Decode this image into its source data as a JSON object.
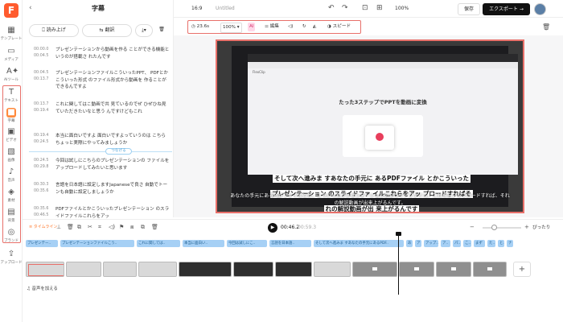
{
  "app": {
    "logo_letter": "F"
  },
  "rail": {
    "items": [
      {
        "label": "テンプレート",
        "icon": "template-icon"
      },
      {
        "label": "メディア",
        "icon": "media-icon"
      },
      {
        "label": "AIツール",
        "icon": "ai-icon"
      },
      {
        "label": "テキスト",
        "icon": "text-icon"
      },
      {
        "label": "字幕",
        "icon": "subtitle-icon"
      },
      {
        "label": "ビデオ",
        "icon": "video-icon"
      },
      {
        "label": "画像",
        "icon": "image-icon"
      },
      {
        "label": "音声",
        "icon": "audio-icon"
      },
      {
        "label": "素材",
        "icon": "elements-icon"
      },
      {
        "label": "背景",
        "icon": "background-icon"
      },
      {
        "label": "ブランド",
        "icon": "brand-icon"
      },
      {
        "label": "アップロード",
        "icon": "upload-icon"
      }
    ]
  },
  "panel": {
    "title": "字幕",
    "read_aloud": "読み上げ",
    "translate": "翻訳",
    "split_label": "つなげる",
    "subtitles": [
      {
        "start": "00:00.0",
        "end": "00:04.5",
        "text": "プレゼンテーションから動画を作る ことができる機能というのが搭載さ れたんです"
      },
      {
        "start": "00:04.5",
        "end": "00:13.7",
        "text": "プレゼンテーションファイルこういったPPT、 PDFとかこういった形式 のファイル形式から動画を 作ることができるんですよ"
      },
      {
        "start": "00:13.7",
        "end": "00:19.4",
        "text": "これに関してはこ動画で共 見ているのでぜ ひぜひね見ていただきたいなと思う んですけどもこれ"
      },
      {
        "start": "00:19.4",
        "end": "00:24.5",
        "text": "本当に面白いですよ 面白いですよっていうのは こちらちょっと実際にやってみましょうか"
      },
      {
        "start": "00:24.5",
        "end": "00:29.8",
        "text": "今回は試しにこちらのプレゼンテーションの ファイルをアップロードしてみたいと思います"
      },
      {
        "start": "00:30.3",
        "end": "00:35.6",
        "text": "言語を日本語に設定しますJapaneseで良さ 自動でトーンも自動に設定しましょうか"
      },
      {
        "start": "00:35.6",
        "end": "00:46.5",
        "text": "PDFファイルとかこういったプレゼンテーション のスライドファイルこれらをアッ"
      }
    ]
  },
  "topbar": {
    "ratio": "16:9",
    "title": "Untitled",
    "zoom": "100%",
    "save": "保存",
    "export": "エクスポート →"
  },
  "props": {
    "duration": "23.6s",
    "zoom": "100%",
    "ai": "AI",
    "edit": "編集",
    "speed": "スピード"
  },
  "video": {
    "page_title": "たった3ステップでPPTを動画に変換",
    "app_name": "FlexClip",
    "caption_main": [
      "そして次へ進みま すあなたの手元に あるPDFファイル とかこういった",
      "プレゼンテーション のスライドファ イルこれらをアッ プロードすればそ",
      "れの解説動画が出 来上がるんです"
    ],
    "caption_sub": "あなたの手元にあるPDFファイルとか、こういったプレゼンテーションのスライドファイル、これらをアップロードすれば、それの解説動画が出来上がるんです。"
  },
  "playback": {
    "timeline_label": "タイムライン",
    "current": "00:46.2",
    "total": "00:59.3",
    "fit": "ぴったり"
  },
  "timeline": {
    "chips": [
      "プレゼンテー..",
      "プレゼンテーションファイルこう..",
      "これに関しては..",
      "本当に面白い..",
      "今回は試しにこ..",
      "言語を日本語..",
      "そして次へ進みま すあなたの手元にあるPDF..",
      "あ",
      "ア",
      "アップ..",
      "ア..",
      "パ..",
      "こ..",
      "まず",
      "た..",
      "と..",
      "ナ"
    ],
    "add_audio": "音声を加える"
  }
}
